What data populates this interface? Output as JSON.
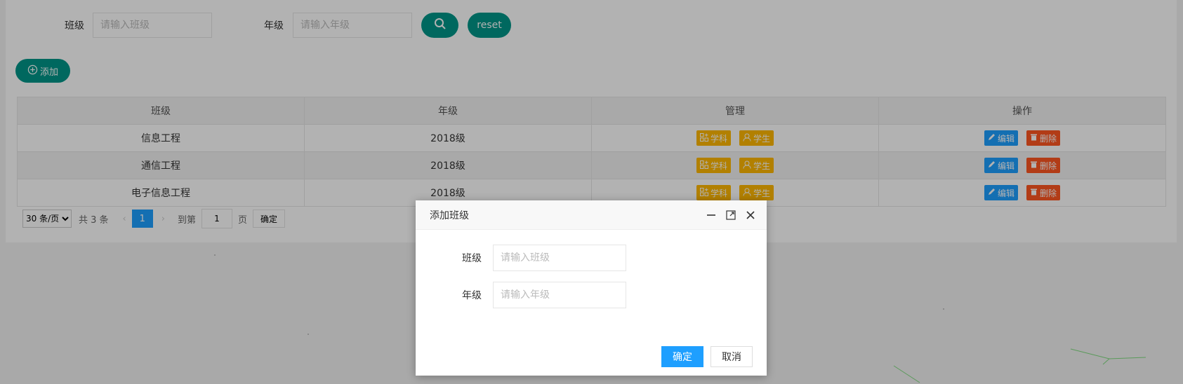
{
  "search": {
    "class_label": "班级",
    "class_placeholder": "请输入班级",
    "grade_label": "年级",
    "grade_placeholder": "请输入年级",
    "search_icon": "search-icon",
    "reset_label": "reset"
  },
  "toolbar": {
    "add_label": "添加",
    "add_icon": "plus-circle-icon"
  },
  "table": {
    "headers": [
      "班级",
      "年级",
      "管理",
      "操作"
    ],
    "subject_label": "学科",
    "student_label": "学生",
    "edit_label": "编辑",
    "delete_label": "删除",
    "rows": [
      {
        "class": "信息工程",
        "grade": "2018级"
      },
      {
        "class": "通信工程",
        "grade": "2018级"
      },
      {
        "class": "电子信息工程",
        "grade": "2018级"
      }
    ]
  },
  "pager": {
    "page_size": "30 条/页",
    "total": "共 3 条",
    "current_page": "1",
    "goto_label": "到第",
    "goto_value": "1",
    "page_label": "页",
    "confirm_label": "确定"
  },
  "modal": {
    "title": "添加班级",
    "class_label": "班级",
    "class_placeholder": "请输入班级",
    "grade_label": "年级",
    "grade_placeholder": "请输入年级",
    "ok_label": "确定",
    "cancel_label": "取消"
  },
  "colors": {
    "teal": "#009688",
    "blue": "#1E9FFF",
    "orange": "#FFB800",
    "red": "#FF5722"
  }
}
